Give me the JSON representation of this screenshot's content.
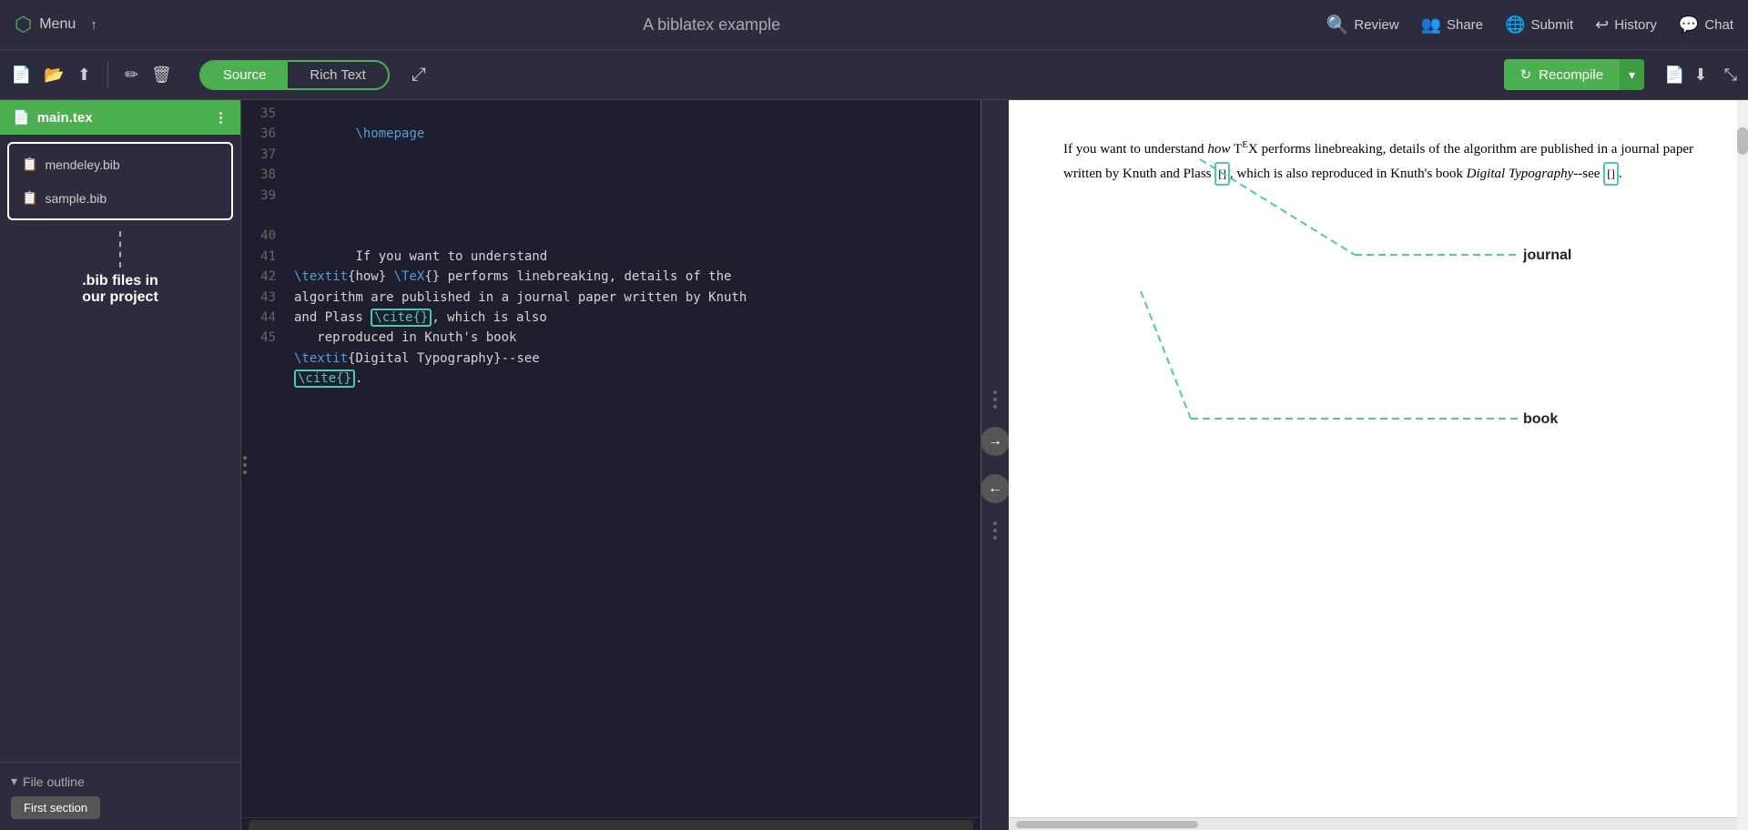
{
  "topbar": {
    "menu_label": "Menu",
    "title": "A biblatex example",
    "review_label": "Review",
    "share_label": "Share",
    "submit_label": "Submit",
    "history_label": "History",
    "chat_label": "Chat"
  },
  "toolbar": {
    "source_label": "Source",
    "richtext_label": "Rich Text",
    "recompile_label": "Recompile"
  },
  "sidebar": {
    "main_file": "main.tex",
    "bib_files": [
      "mendeley.bib",
      "sample.bib"
    ],
    "annotation": ".bib files in\nour project",
    "outline_header": "File outline",
    "outline_item": "First section"
  },
  "editor": {
    "line_numbers": [
      35,
      36,
      37,
      38,
      39,
      40,
      41,
      42,
      43,
      44,
      45
    ],
    "lines": [
      "\\homepage",
      "",
      "",
      "",
      "If you want to understand",
      "\\textit{how} \\TeX{} performs",
      "linebreaking, details of the",
      "algorithm are published in a",
      "journal paper written by Knuth",
      "and Plass \\cite{}, which is also",
      "   reproduced in Knuth's book",
      "\\textit{Digital Typography}--see",
      "\\cite{}.",
      "",
      ""
    ]
  },
  "preview": {
    "text": "If you want to understand how TeX performs linebreaking, details of the algorithm are published in a journal paper written by Knuth and Plass [], which is also reproduced in Knuth's book Digital Typography--see [].",
    "annotations": {
      "journal_label": "journal",
      "book_label": "book"
    }
  },
  "icons": {
    "menu": "☰",
    "upload": "↑",
    "new_file": "📄",
    "open_folder": "📂",
    "upload_file": "⬆",
    "edit": "✏",
    "delete": "🗑",
    "more": "⋮",
    "review": "Ⓐ",
    "share": "👥",
    "submit": "🌐",
    "history": "↩",
    "chat": "💬",
    "recompile_icon": "↻",
    "arrow_right": "→",
    "arrow_left": "←",
    "chevron_down": "▾",
    "chevron_right": "›",
    "expand": "⤢",
    "compress": "⤡",
    "file_tex": "📄",
    "file_bib": "📋",
    "doc_icon": "📄",
    "download_icon": "⬇"
  },
  "colors": {
    "green": "#4caf50",
    "dark_bg": "#2c2c3e",
    "editor_bg": "#1e1e2e",
    "teal": "#4ec9b0",
    "blue": "#569cd6"
  }
}
